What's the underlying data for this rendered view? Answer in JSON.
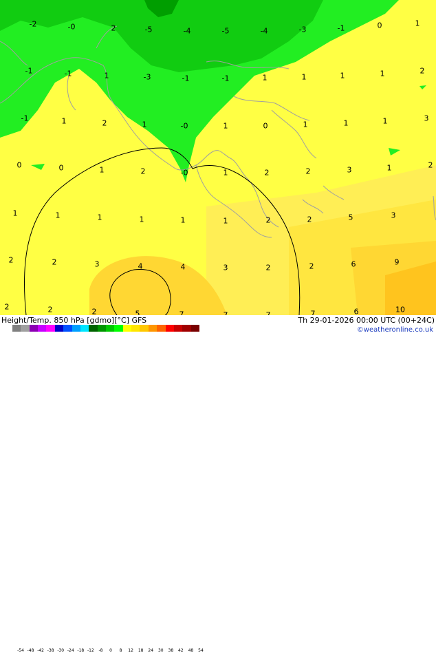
{
  "map": {
    "temp_labels": [
      {
        "t": "-2"
      },
      {
        "t": "-0"
      },
      {
        "t": "2"
      },
      {
        "t": "-5"
      },
      {
        "t": "-4"
      },
      {
        "t": "-5"
      },
      {
        "t": "-4"
      },
      {
        "t": "-3"
      },
      {
        "t": "-1"
      },
      {
        "t": "0"
      },
      {
        "t": "1"
      },
      {
        "t": "-1"
      },
      {
        "t": "-1"
      },
      {
        "t": "1"
      },
      {
        "t": "-3"
      },
      {
        "t": "-1"
      },
      {
        "t": "-1"
      },
      {
        "t": "1"
      },
      {
        "t": "1"
      },
      {
        "t": "1"
      },
      {
        "t": "1"
      },
      {
        "t": "2"
      },
      {
        "t": "-1"
      },
      {
        "t": "1"
      },
      {
        "t": "2"
      },
      {
        "t": "1"
      },
      {
        "t": "-0"
      },
      {
        "t": "1"
      },
      {
        "t": "0"
      },
      {
        "t": "1"
      },
      {
        "t": "1"
      },
      {
        "t": "1"
      },
      {
        "t": "3"
      },
      {
        "t": "0"
      },
      {
        "t": "0"
      },
      {
        "t": "1"
      },
      {
        "t": "2"
      },
      {
        "t": "-0"
      },
      {
        "t": "1"
      },
      {
        "t": "2"
      },
      {
        "t": "2"
      },
      {
        "t": "3"
      },
      {
        "t": "1"
      },
      {
        "t": "2"
      },
      {
        "t": "1"
      },
      {
        "t": "1"
      },
      {
        "t": "1"
      },
      {
        "t": "1"
      },
      {
        "t": "1"
      },
      {
        "t": "1"
      },
      {
        "t": "2"
      },
      {
        "t": "2"
      },
      {
        "t": "5"
      },
      {
        "t": "3"
      },
      {
        "t": "2"
      },
      {
        "t": "2"
      },
      {
        "t": "3"
      },
      {
        "t": "4"
      },
      {
        "t": "4"
      },
      {
        "t": "3"
      },
      {
        "t": "2"
      },
      {
        "t": "2"
      },
      {
        "t": "6"
      },
      {
        "t": "9"
      },
      {
        "t": "2"
      },
      {
        "t": "2"
      },
      {
        "t": "2"
      },
      {
        "t": "5"
      },
      {
        "t": "7"
      },
      {
        "t": "7"
      },
      {
        "t": "7"
      },
      {
        "t": "7"
      },
      {
        "t": "6"
      },
      {
        "t": "10"
      }
    ]
  },
  "footer": {
    "title": "Height/Temp. 850 hPa [gdmo][°C] GFS",
    "datetime": "Th 29-01-2026 00:00 UTC (00+24C)",
    "credit": "©weatheronline.co.uk",
    "scale_ticks": [
      "-54",
      "-48",
      "-42",
      "-38",
      "-30",
      "-24",
      "-18",
      "-12",
      "-8",
      "0",
      "8",
      "12",
      "18",
      "24",
      "30",
      "38",
      "42",
      "48",
      "54"
    ],
    "scale_colors": [
      "#808080",
      "#a0a0a0",
      "#8c00b4",
      "#c800ff",
      "#ff00ff",
      "#0000c8",
      "#0050ff",
      "#00a0ff",
      "#00e6ff",
      "#006400",
      "#009600",
      "#00c800",
      "#00ff00",
      "#ffff00",
      "#ffe600",
      "#ffc800",
      "#ff9600",
      "#ff6400",
      "#ff0000",
      "#c80000",
      "#a00000",
      "#780000"
    ]
  },
  "colors": {
    "sea_yellow": "#ffff44",
    "land_yellow": "#ffee55",
    "warm": "#ffd733",
    "warmer": "#ffc41e",
    "green_light": "#22ee22",
    "green_mid": "#11cc11",
    "green_dark": "#009e00",
    "coast": "#a0a0a0",
    "contour": "#000000"
  }
}
